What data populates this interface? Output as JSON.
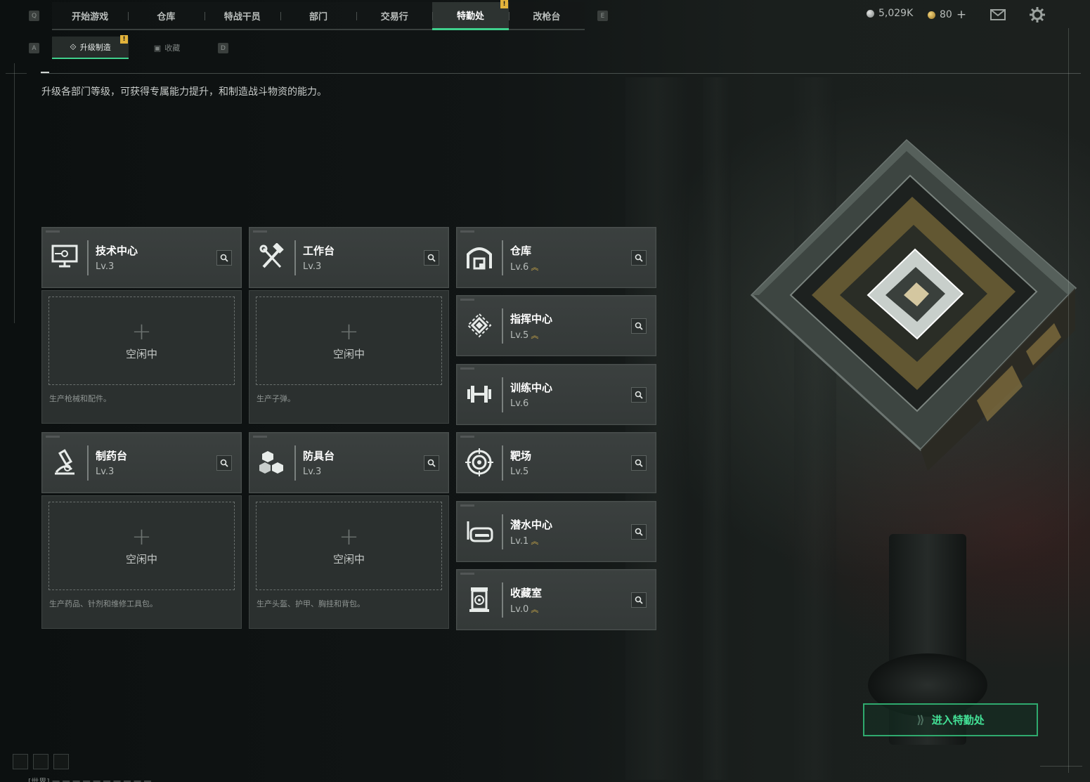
{
  "top_nav": {
    "key_left": "Q",
    "key_right": "E",
    "tabs": [
      {
        "label": "开始游戏",
        "active": false
      },
      {
        "label": "仓库",
        "active": false
      },
      {
        "label": "特战干员",
        "active": false
      },
      {
        "label": "部门",
        "active": false
      },
      {
        "label": "交易行",
        "active": false
      },
      {
        "label": "特勤处",
        "active": true,
        "badge": "!"
      },
      {
        "label": "改枪台",
        "active": false
      }
    ]
  },
  "sub_nav": {
    "key_left": "A",
    "key_right": "D",
    "tabs": [
      {
        "label": "升级制造",
        "active": true,
        "badge": "!"
      },
      {
        "label": "收藏",
        "active": false
      }
    ]
  },
  "currency": {
    "silver": "5,029K",
    "gold": "80",
    "add_symbol": "+"
  },
  "description": "升级各部门等级，可获得专属能力提升，和制造战斗物资的能力。",
  "idle_label": "空闲中",
  "production": {
    "tech_center": {
      "name": "技术中心",
      "level": "Lv.3",
      "upgrade": false,
      "desc": "生产枪械和配件。"
    },
    "workbench": {
      "name": "工作台",
      "level": "Lv.3",
      "upgrade": false,
      "desc": "生产子弹。"
    },
    "pharmacy": {
      "name": "制药台",
      "level": "Lv.3",
      "upgrade": false,
      "desc": "生产药品、针剂和维修工具包。"
    },
    "armor_bench": {
      "name": "防具台",
      "level": "Lv.3",
      "upgrade": false,
      "desc": "生产头盔、护甲、胸挂和背包。"
    }
  },
  "facilities": [
    {
      "name": "仓库",
      "level": "Lv.6",
      "upgrade": true,
      "icon": "warehouse-icon"
    },
    {
      "name": "指挥中心",
      "level": "Lv.5",
      "upgrade": true,
      "icon": "command-icon"
    },
    {
      "name": "训练中心",
      "level": "Lv.6",
      "upgrade": false,
      "icon": "dumbbell-icon"
    },
    {
      "name": "靶场",
      "level": "Lv.5",
      "upgrade": false,
      "icon": "target-icon"
    },
    {
      "name": "潜水中心",
      "level": "Lv.1",
      "upgrade": true,
      "icon": "diving-mask-icon"
    },
    {
      "name": "收藏室",
      "level": "Lv.0",
      "upgrade": true,
      "icon": "collection-icon"
    }
  ],
  "enter_button": "进入特勤处",
  "chat_preview": "[世界] 一 一 一 一 一 一 一 一 一 一"
}
